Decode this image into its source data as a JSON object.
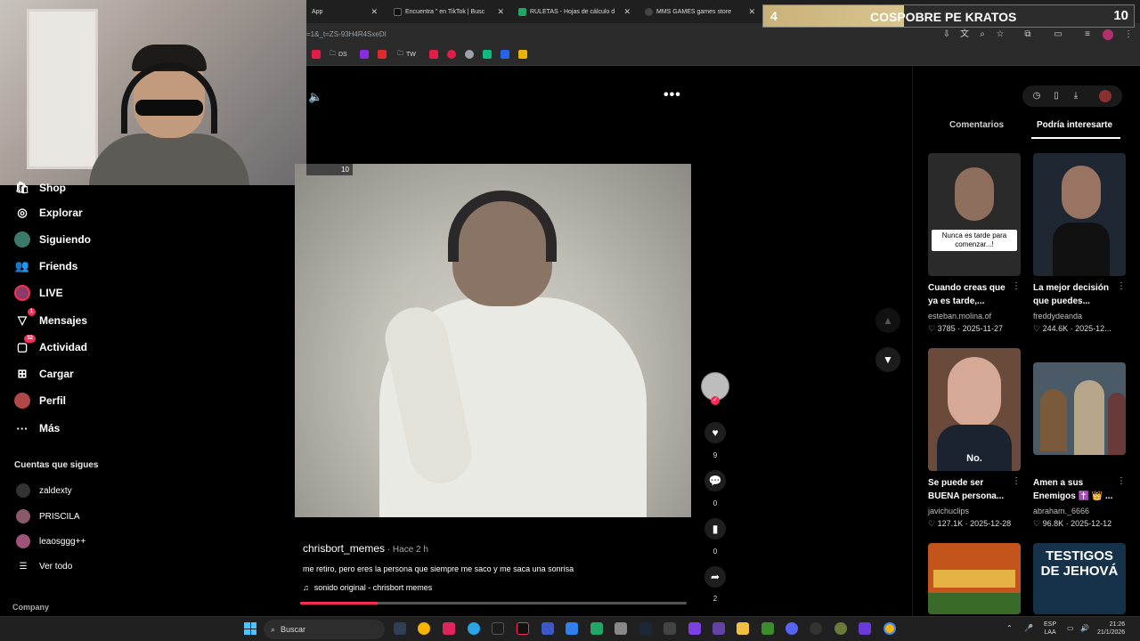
{
  "browser": {
    "tabs": [
      {
        "label": "App",
        "color": "#555555"
      },
      {
        "label": "Encuentra \" en TikTok | Busc",
        "color": "#111111"
      },
      {
        "label": "RULETAS - Hojas de cálculo d",
        "color": "#23a566"
      },
      {
        "label": "MMS GAMES games store",
        "color": "#444444"
      }
    ],
    "url": "=1&_t=ZS-93H4R4SxeDI",
    "bookmarks": [
      {
        "label": "DS",
        "color": "#888888"
      },
      {
        "label": "",
        "color": "#8a2be2"
      },
      {
        "label": "",
        "color": "#e02a2a"
      },
      {
        "label": "TW",
        "color": "#888888"
      },
      {
        "label": "",
        "color": "#e11d48"
      },
      {
        "label": "",
        "color": "#e11d48"
      },
      {
        "label": "",
        "color": "#9ca3af"
      },
      {
        "label": "",
        "color": "#10b981"
      },
      {
        "label": "",
        "color": "#2563eb"
      },
      {
        "label": "",
        "color": "#eab308"
      }
    ]
  },
  "banner": {
    "left_number": "4",
    "title": "COSPOBRE PE KRATOS",
    "right_number": "10"
  },
  "sidebar": {
    "items": [
      {
        "label": "Shop",
        "icon": "shop-icon"
      },
      {
        "label": "Explorar",
        "icon": "compass-icon"
      },
      {
        "label": "Siguiendo",
        "icon": "following-avatar"
      },
      {
        "label": "Friends",
        "icon": "friends-icon"
      },
      {
        "label": "LIVE",
        "icon": "live-avatar"
      },
      {
        "label": "Mensajes",
        "icon": "send-icon",
        "badge": "1"
      },
      {
        "label": "Actividad",
        "icon": "inbox-icon",
        "badge": "32"
      },
      {
        "label": "Cargar",
        "icon": "upload-icon"
      },
      {
        "label": "Perfil",
        "icon": "profile-avatar"
      },
      {
        "label": "Más",
        "icon": "more-icon"
      }
    ],
    "following_header": "Cuentas que sigues",
    "following": [
      {
        "name": "zaldexty",
        "color": "#333333"
      },
      {
        "name": "PRISCILA",
        "color": "#8a5a6a"
      },
      {
        "name": "leaosggg++",
        "color": "#a0527a"
      }
    ],
    "see_all": "Ver todo",
    "company": "Company"
  },
  "video": {
    "timer": "10",
    "author": "chrisbort_memes",
    "time_ago": " · Hace 2 h",
    "caption": "me retiro, pero eres la persona que siempre me saco y me saca una sonrisa",
    "sound": "sonido original - chrisbort memes",
    "progress": 0.2
  },
  "actions": {
    "likes": "9",
    "comments": "0",
    "saves": "0",
    "shares": "2"
  },
  "right_panel": {
    "tabs": [
      "Comentarios",
      "Podría interesarte"
    ],
    "videos": [
      {
        "overlay": "Nunca es tarde para comenzar...!",
        "title": "Cuando creas que ya es tarde,...",
        "user": "esteban.molina.of",
        "likes": "3785",
        "date": "2025-11-27",
        "bg": "#2a2a2a"
      },
      {
        "overlay": "",
        "title": "La mejor decisión que puedes...",
        "user": "freddydeanda",
        "likes": "244.6K",
        "date": "2025-12...",
        "bg": "#1f2733"
      },
      {
        "overlay": "No.",
        "title": "Se puede ser BUENA persona...",
        "user": "javichuclips",
        "likes": "127.1K",
        "date": "2025-12-28",
        "bg": "#6a4a3a"
      },
      {
        "overlay": "",
        "title": "Amen a sus Enemigos ✝️ 👑 ...",
        "user": "abraham._6666",
        "likes": "96.8K",
        "date": "2025-12-12",
        "bg": "#4a5a66"
      },
      {
        "overlay": "",
        "title": "",
        "user": "",
        "likes": "",
        "date": "",
        "bg": "#c2541c"
      },
      {
        "overlay": "TESTIGOS DE JEHOVÁ",
        "title": "",
        "user": "",
        "likes": "",
        "date": "",
        "bg": "#16324a"
      }
    ]
  },
  "taskbar": {
    "search": "Buscar",
    "lang_top": "ESP",
    "lang_bottom": "LAA",
    "time": "21:26",
    "date": "21/1/2026"
  }
}
